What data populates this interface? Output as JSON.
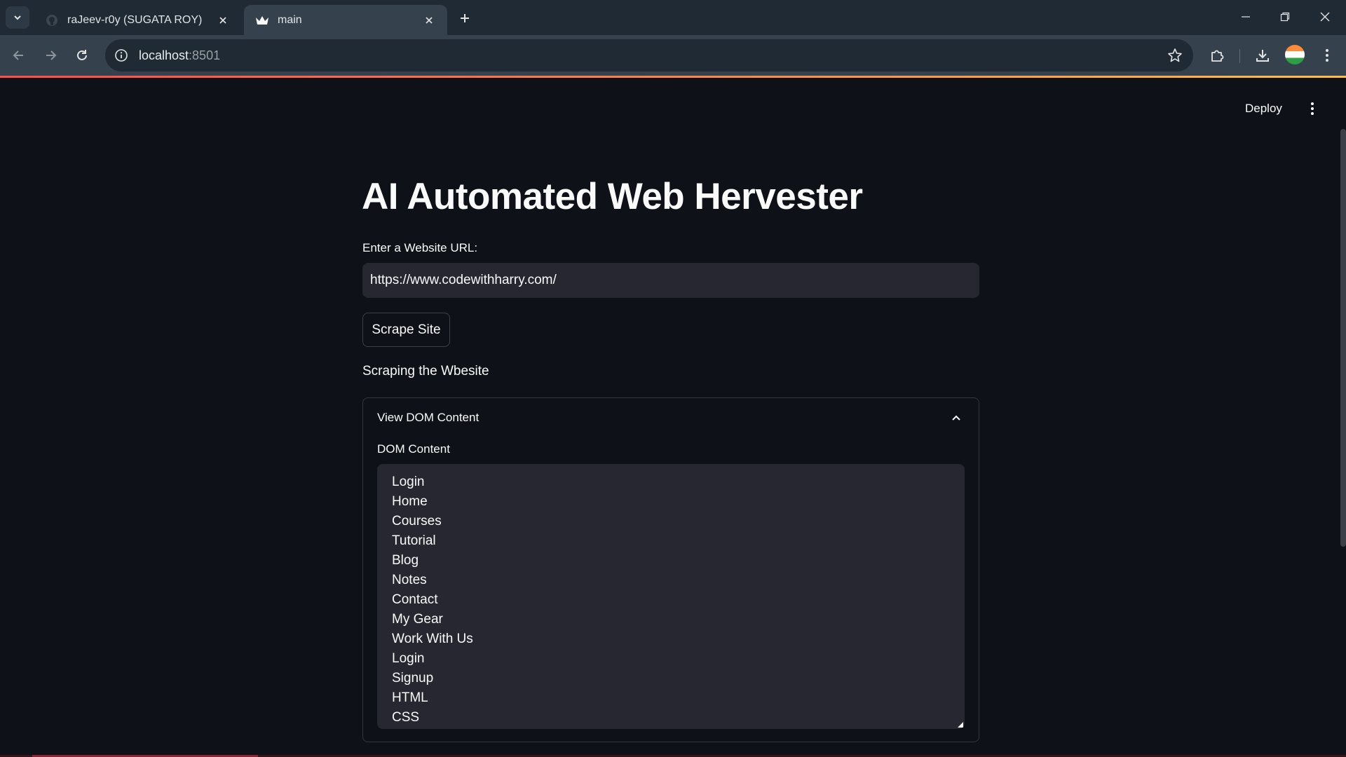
{
  "browser": {
    "tabs": [
      {
        "label": "raJeev-r0y (SUGATA ROY)",
        "favicon": "github-icon",
        "active": false
      },
      {
        "label": "main",
        "favicon": "streamlit-crown-icon",
        "active": true
      }
    ],
    "url_host": "localhost",
    "url_port": ":8501"
  },
  "header": {
    "deploy_label": "Deploy"
  },
  "main": {
    "title": "AI Automated Web Hervester",
    "url_label": "Enter a Website URL:",
    "url_value": "https://www.codewithharry.com/",
    "scrape_button": "Scrape Site",
    "status_text": "Scraping the Wbesite",
    "expander": {
      "title": "View DOM Content",
      "expanded": true,
      "textarea_label": "DOM Content",
      "lines": [
        "Login",
        "Home",
        "Courses",
        "Tutorial",
        "Blog",
        "Notes",
        "Contact",
        "My Gear",
        "Work With Us",
        "Login",
        "Signup",
        "HTML",
        "CSS"
      ]
    }
  },
  "colors": {
    "app_background": "#0e1117",
    "input_background": "#262730",
    "text": "#fafafa",
    "accent_red": "#ff4b4b",
    "accent_yellow": "#ffbd45"
  }
}
